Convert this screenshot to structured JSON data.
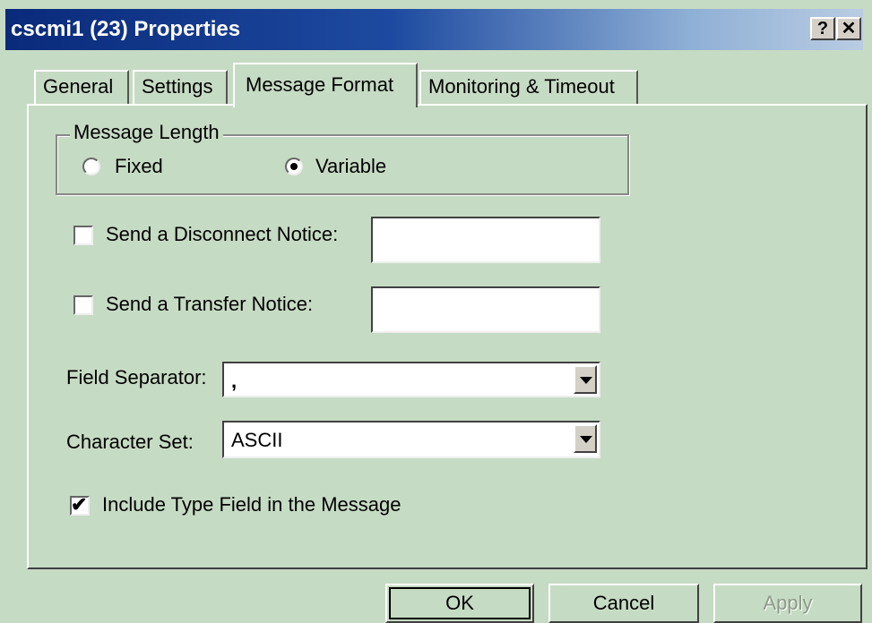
{
  "window": {
    "title": "cscmi1 (23) Properties",
    "help_label": "?",
    "close_label": "✕"
  },
  "tabs": [
    {
      "label": "General"
    },
    {
      "label": "Settings"
    },
    {
      "label": "Message Format",
      "active": true
    },
    {
      "label": "Monitoring & Timeout"
    }
  ],
  "message_length": {
    "legend": "Message Length",
    "options": [
      {
        "label": "Fixed",
        "selected": false
      },
      {
        "label": "Variable",
        "selected": true
      }
    ]
  },
  "disconnect_notice": {
    "label": "Send a Disconnect Notice:",
    "checked": false,
    "value": ""
  },
  "transfer_notice": {
    "label": "Send a Transfer Notice:",
    "checked": false,
    "value": ""
  },
  "field_separator": {
    "label": "Field Separator:",
    "value": ","
  },
  "character_set": {
    "label": "Character Set:",
    "value": "ASCII"
  },
  "include_type_field": {
    "label": "Include Type Field in the Message",
    "checked": true
  },
  "buttons": {
    "ok": "OK",
    "cancel": "Cancel",
    "apply": "Apply"
  },
  "colors": {
    "title_bar_start": "#0a2a7a",
    "dialog_bg": "#c6dbc3"
  }
}
